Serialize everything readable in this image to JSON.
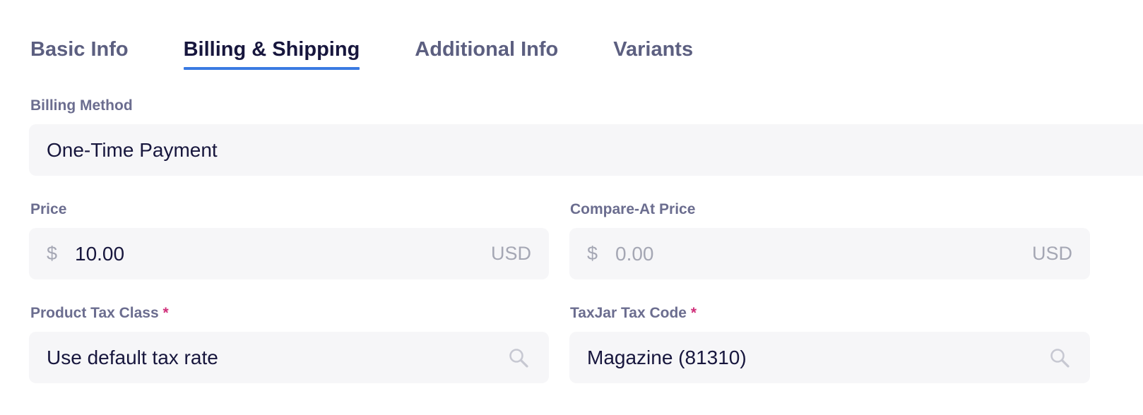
{
  "tabs": [
    {
      "label": "Basic Info",
      "active": false
    },
    {
      "label": "Billing & Shipping",
      "active": true
    },
    {
      "label": "Additional Info",
      "active": false
    },
    {
      "label": "Variants",
      "active": false
    }
  ],
  "billing_method": {
    "label": "Billing Method",
    "value": "One-Time Payment"
  },
  "price": {
    "label": "Price",
    "currency_symbol": "$",
    "value": "10.00",
    "unit": "USD"
  },
  "compare_at_price": {
    "label": "Compare-At Price",
    "currency_symbol": "$",
    "placeholder": "0.00",
    "unit": "USD"
  },
  "product_tax_class": {
    "label": "Product Tax Class",
    "required_mark": "*",
    "value": "Use default tax rate",
    "icon": "search-icon"
  },
  "taxjar_tax_code": {
    "label": "TaxJar Tax Code",
    "required_mark": "*",
    "value": "Magazine (81310)",
    "icon": "search-icon"
  },
  "colors": {
    "accent": "#3a7ae2",
    "required": "#d0307a",
    "field_bg": "#f6f6f8",
    "text_primary": "#17163d",
    "text_label": "#6b6d8f"
  }
}
